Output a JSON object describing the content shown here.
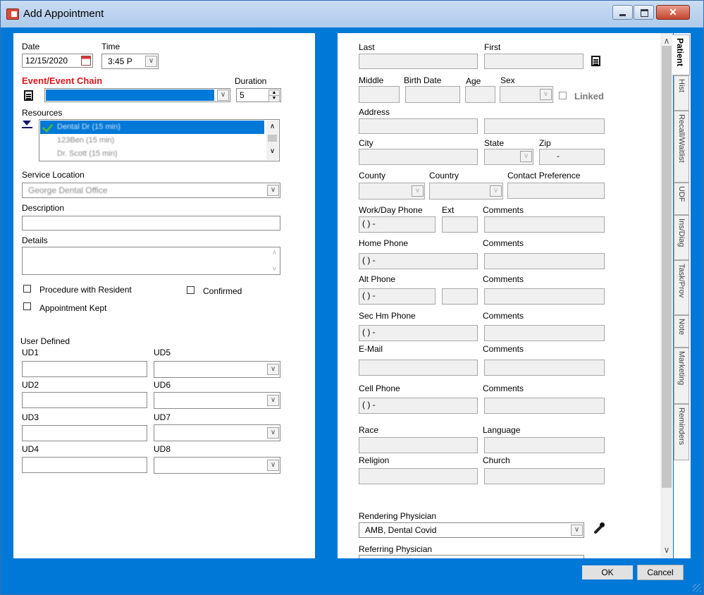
{
  "window": {
    "title": "Add Appointment"
  },
  "left": {
    "date": {
      "label": "Date",
      "value": "12/15/2020"
    },
    "time": {
      "label": "Time",
      "value": "3:45 P"
    },
    "event_chain": {
      "label": "Event/Event Chain",
      "value": ""
    },
    "duration": {
      "label": "Duration",
      "value": "5"
    },
    "resources": {
      "label": "Resources",
      "items": [
        "Dental Dr (15 min)",
        "123Ben (15 min)",
        "Dr. Scott (15 min)"
      ]
    },
    "service_location": {
      "label": "Service Location",
      "value": "George Dental Office"
    },
    "description": {
      "label": "Description",
      "value": ""
    },
    "details": {
      "label": "Details",
      "value": ""
    },
    "checkboxes": {
      "procedure_with_resident": "Procedure with Resident",
      "appointment_kept": "Appointment Kept",
      "confirmed": "Confirmed"
    },
    "user_defined": {
      "label": "User Defined",
      "ud1": "UD1",
      "ud2": "UD2",
      "ud3": "UD3",
      "ud4": "UD4",
      "ud5": "UD5",
      "ud6": "UD6",
      "ud7": "UD7",
      "ud8": "UD8"
    }
  },
  "right": {
    "last": "Last",
    "first": "First",
    "middle": "Middle",
    "birth_date": "Birth Date",
    "age": "Age",
    "sex": "Sex",
    "linked": "Linked",
    "address": "Address",
    "city": "City",
    "state": "State",
    "zip": "Zip",
    "zip_value": "-",
    "county": "County",
    "country": "Country",
    "contact_preference": "Contact Preference",
    "work_day_phone": "Work/Day Phone",
    "ext": "Ext",
    "comments": "Comments",
    "home_phone": "Home Phone",
    "alt_phone": "Alt Phone",
    "sec_hm_phone": "Sec Hm Phone",
    "email": "E-Mail",
    "cell_phone": "Cell Phone",
    "phone_mask": "(   )   -",
    "race": "Race",
    "language": "Language",
    "religion": "Religion",
    "church": "Church",
    "rendering_physician": {
      "label": "Rendering Physician",
      "value": "AMB, Dental Covid"
    },
    "referring_physician": {
      "label": "Referring Physician"
    }
  },
  "tabs": [
    "Patient",
    "Hist",
    "Recall/Waitlist",
    "UDF",
    "Ins/Diag",
    "Task/Prov",
    "Note",
    "Marketing",
    "Reminders"
  ],
  "buttons": {
    "ok": "OK",
    "cancel": "Cancel"
  },
  "icons": {
    "calendar": "calendar-icon",
    "lookup": "notepad-icon",
    "dropper": "eyedropper-icon"
  }
}
